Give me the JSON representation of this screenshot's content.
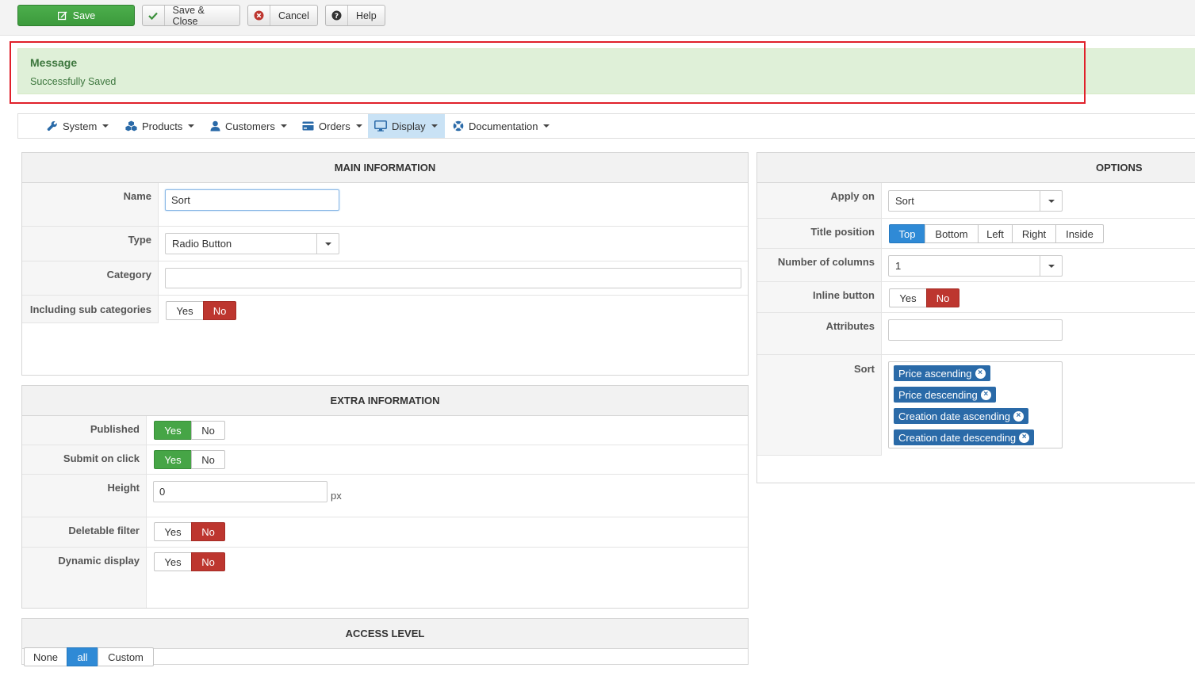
{
  "toolbar": {
    "save": "Save",
    "save_close": "Save & Close",
    "cancel": "Cancel",
    "help": "Help"
  },
  "message": {
    "title": "Message",
    "text": "Successfully Saved"
  },
  "nav": {
    "items": [
      {
        "label": "System",
        "icon": "wrench-icon"
      },
      {
        "label": "Products",
        "icon": "cubes-icon"
      },
      {
        "label": "Customers",
        "icon": "user-icon"
      },
      {
        "label": "Orders",
        "icon": "credit-card-icon"
      },
      {
        "label": "Display",
        "icon": "monitor-icon",
        "active": true
      },
      {
        "label": "Documentation",
        "icon": "life-ring-icon"
      }
    ]
  },
  "main_info": {
    "heading": "MAIN INFORMATION",
    "name_label": "Name",
    "name_value": "Sort",
    "type_label": "Type",
    "type_value": "Radio Button",
    "category_label": "Category",
    "category_value": "",
    "subcat_label": "Including sub categories",
    "subcat": {
      "yes": "Yes",
      "no": "No",
      "selected": "No"
    }
  },
  "extra_info": {
    "heading": "EXTRA INFORMATION",
    "published_label": "Published",
    "published": {
      "yes": "Yes",
      "no": "No",
      "selected": "Yes"
    },
    "submit_label": "Submit on click",
    "submit": {
      "yes": "Yes",
      "no": "No",
      "selected": "Yes"
    },
    "height_label": "Height",
    "height_value": "0",
    "height_unit": "px",
    "deletable_label": "Deletable filter",
    "deletable": {
      "yes": "Yes",
      "no": "No",
      "selected": "No"
    },
    "dynamic_label": "Dynamic display",
    "dynamic": {
      "yes": "Yes",
      "no": "No",
      "selected": "No"
    }
  },
  "access": {
    "heading": "ACCESS LEVEL",
    "options": [
      "None",
      "all",
      "Custom"
    ],
    "selected": "all"
  },
  "options": {
    "heading": "OPTIONS",
    "apply_label": "Apply on",
    "apply_value": "Sort",
    "title_pos_label": "Title position",
    "title_pos_options": [
      "Top",
      "Bottom",
      "Left",
      "Right",
      "Inside"
    ],
    "title_pos_selected": "Top",
    "columns_label": "Number of columns",
    "columns_value": "1",
    "inline_label": "Inline button",
    "inline": {
      "yes": "Yes",
      "no": "No",
      "selected": "No"
    },
    "attributes_label": "Attributes",
    "attributes_value": "",
    "sort_label": "Sort",
    "sort_tags": [
      "Price ascending",
      "Price descending",
      "Creation date ascending",
      "Creation date descending"
    ]
  },
  "colors": {
    "success_bg": "#dff0d8",
    "success_text": "#3c763d",
    "highlight_outline": "#e0202a",
    "btn_green": "#46a546",
    "btn_red": "#bd362f",
    "btn_blue": "#2f8ad6",
    "tag_blue": "#2a6aa8"
  }
}
